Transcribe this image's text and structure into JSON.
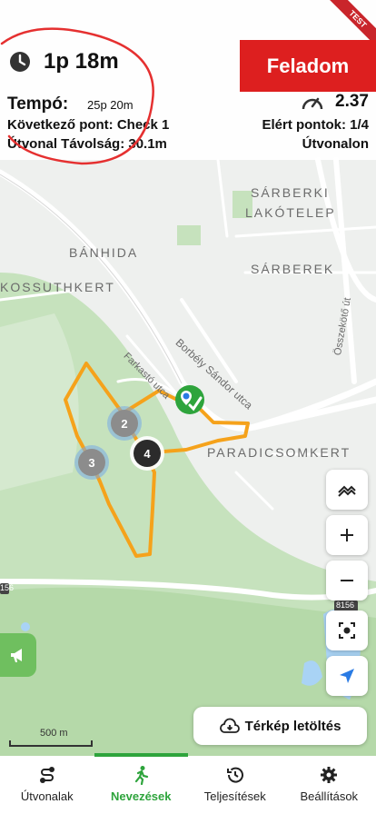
{
  "hud": {
    "timer": "1p 18m",
    "give_up_label": "Feladom",
    "test_ribbon": "TEST",
    "pace_label": "Tempó:",
    "pace_value": "25p 20m",
    "speed_value": "2.37",
    "next_point": "Következő pont:  Check 1",
    "route_distance": "Útvonal Távolság:  30.1m",
    "reached_points": "Elért pontok:  1/4",
    "route_status": "Útvonalon"
  },
  "map": {
    "labels": {
      "sarberki": "SÁRBERKI",
      "lakotelep": "LAKÓTELEP",
      "banhida": "BÁNHIDA",
      "sarberek": "SÁRBEREK",
      "kossuthkert": "KOSSUTHKERT",
      "borbely": "Borbély Sándor utca",
      "osszekoto": "Összekötő út",
      "farkastu": "Farkastó utca",
      "paradicsomkert": "PARADICSOMKERT",
      "road8156a": "8156",
      "road8156b": "156"
    },
    "checkpoints": [
      "2",
      "3",
      "4"
    ],
    "scale_label": "500 m",
    "download_label": "Térkép letöltés",
    "colors": {
      "route": "#f5a21b",
      "green": "#2ea43c",
      "red": "#dd1f1f",
      "water": "#a9d3f5"
    }
  },
  "nav": {
    "items": [
      {
        "label": "Útvonalak",
        "icon": "route-icon"
      },
      {
        "label": "Nevezések",
        "icon": "runner-icon"
      },
      {
        "label": "Teljesítések",
        "icon": "history-icon"
      },
      {
        "label": "Beállítások",
        "icon": "gear-icon"
      }
    ],
    "active": "Nevezések"
  }
}
